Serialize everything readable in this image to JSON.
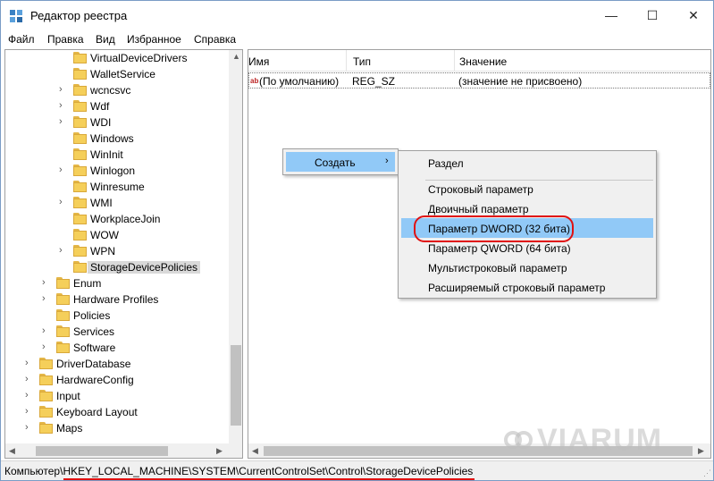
{
  "window": {
    "title": "Редактор реестра",
    "controls": {
      "minimize": "—",
      "maximize": "☐",
      "close": "✕"
    }
  },
  "menu": [
    "Файл",
    "Правка",
    "Вид",
    "Избранное",
    "Справка"
  ],
  "tree": [
    {
      "label": "VirtualDeviceDrivers",
      "level": 3,
      "expandable": false
    },
    {
      "label": "WalletService",
      "level": 3,
      "expandable": false
    },
    {
      "label": "wcncsvc",
      "level": 3,
      "expandable": true
    },
    {
      "label": "Wdf",
      "level": 3,
      "expandable": true
    },
    {
      "label": "WDI",
      "level": 3,
      "expandable": true
    },
    {
      "label": "Windows",
      "level": 3,
      "expandable": false
    },
    {
      "label": "WinInit",
      "level": 3,
      "expandable": false
    },
    {
      "label": "Winlogon",
      "level": 3,
      "expandable": true
    },
    {
      "label": "Winresume",
      "level": 3,
      "expandable": false
    },
    {
      "label": "WMI",
      "level": 3,
      "expandable": true
    },
    {
      "label": "WorkplaceJoin",
      "level": 3,
      "expandable": false
    },
    {
      "label": "WOW",
      "level": 3,
      "expandable": false
    },
    {
      "label": "WPN",
      "level": 3,
      "expandable": true
    },
    {
      "label": "StorageDevicePolicies",
      "level": 3,
      "expandable": false,
      "selected": true
    },
    {
      "label": "Enum",
      "level": 2,
      "expandable": true
    },
    {
      "label": "Hardware Profiles",
      "level": 2,
      "expandable": true
    },
    {
      "label": "Policies",
      "level": 2,
      "expandable": false
    },
    {
      "label": "Services",
      "level": 2,
      "expandable": true
    },
    {
      "label": "Software",
      "level": 2,
      "expandable": true
    },
    {
      "label": "DriverDatabase",
      "level": 1,
      "expandable": true
    },
    {
      "label": "HardwareConfig",
      "level": 1,
      "expandable": true
    },
    {
      "label": "Input",
      "level": 1,
      "expandable": true
    },
    {
      "label": "Keyboard Layout",
      "level": 1,
      "expandable": true
    },
    {
      "label": "Maps",
      "level": 1,
      "expandable": true
    }
  ],
  "list": {
    "columns": [
      "Имя",
      "Тип",
      "Значение"
    ],
    "rows": [
      {
        "name": "(По умолчанию)",
        "type": "REG_SZ",
        "value": "(значение не присвоено)"
      }
    ]
  },
  "context_menu": {
    "label": "Создать",
    "arrow": "›"
  },
  "submenu": [
    "Раздел",
    "Строковый параметр",
    "Двоичный параметр",
    "Параметр DWORD (32 бита)",
    "Параметр QWORD (64 бита)",
    "Мультистроковый параметр",
    "Расширяемый строковый параметр"
  ],
  "submenu_highlighted_index": 3,
  "status": {
    "path": "Компьютер\\HKEY_LOCAL_MACHINE\\SYSTEM\\CurrentControlSet\\Control\\StorageDevicePolicies"
  },
  "watermark": "VIARUM",
  "colors": {
    "highlight": "#91c9f7",
    "annotation_red": "#e01010",
    "folder": "#f5cf5a"
  }
}
